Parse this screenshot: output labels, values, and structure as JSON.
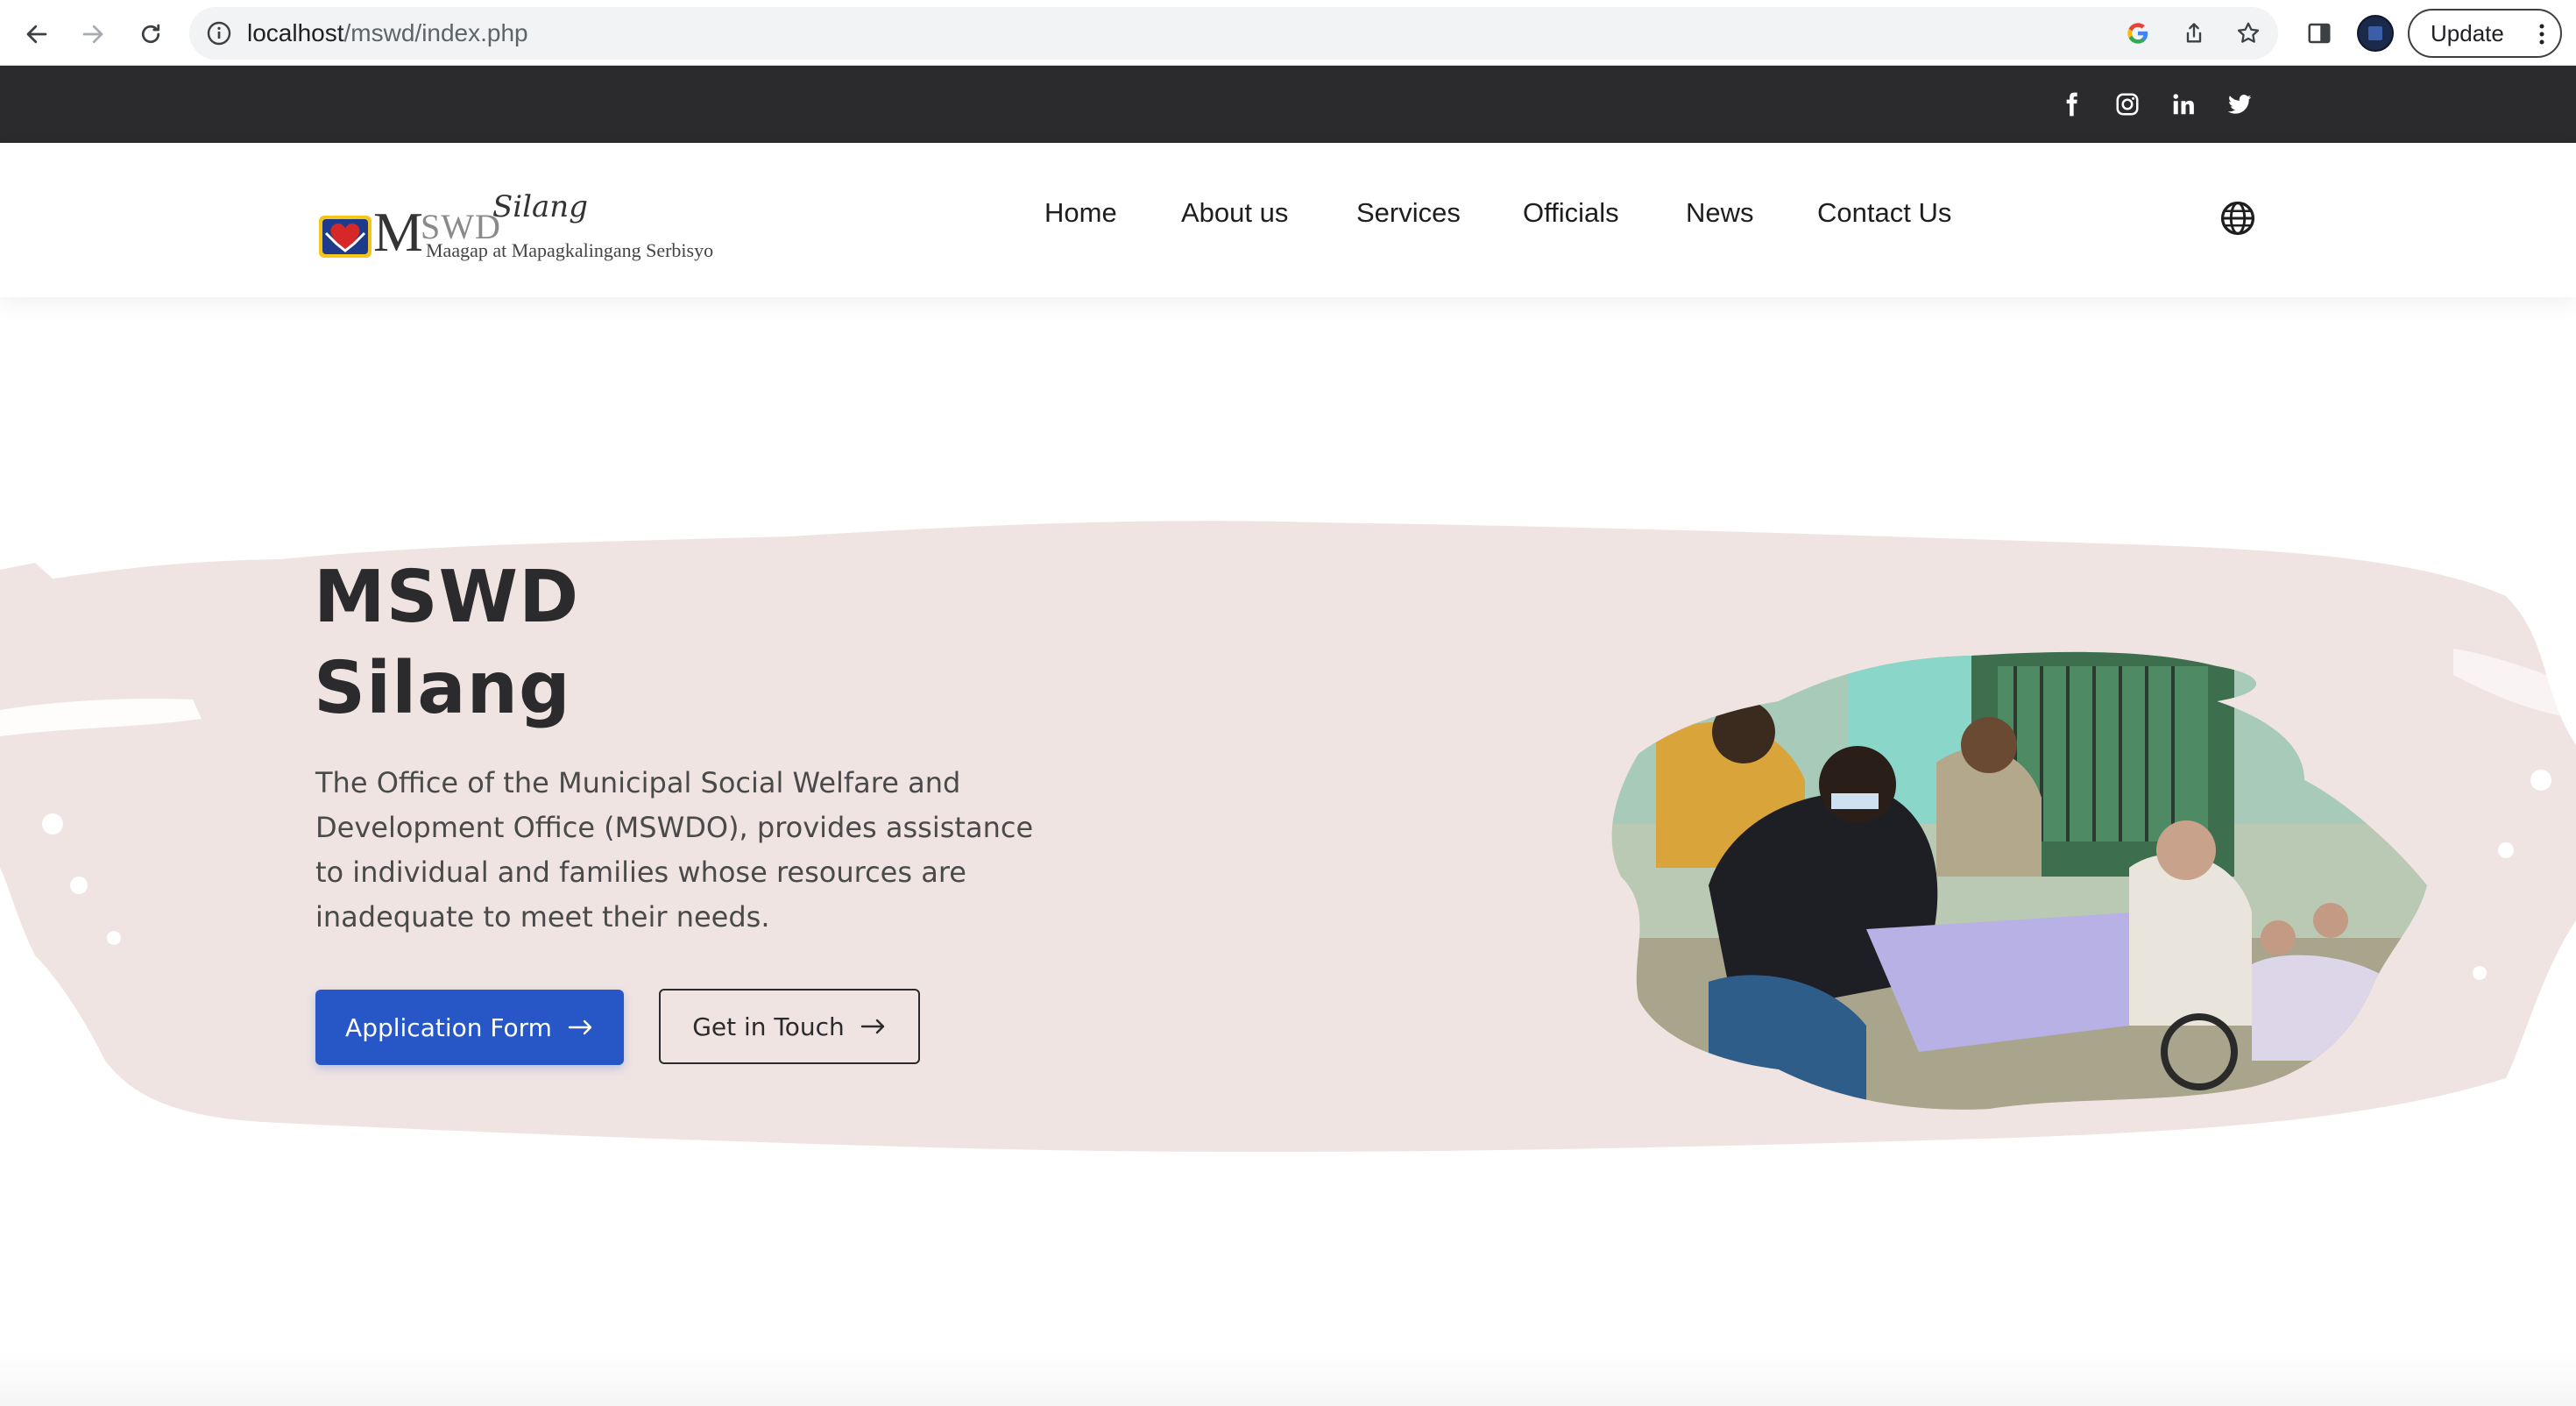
{
  "browser": {
    "url_host": "localhost",
    "url_path": "/mswd/index.php",
    "update_label": "Update"
  },
  "topbar": {
    "social_icons": [
      "facebook-icon",
      "instagram-icon",
      "linkedin-icon",
      "twitter-icon"
    ]
  },
  "header": {
    "logo": {
      "m_letter": "M",
      "swd_text": "SWD",
      "silang_text": "Silang",
      "tagline": "Maagap at Mapagkalingang Serbisyo"
    },
    "nav": [
      "Home",
      "About us",
      "Services",
      "Officials",
      "News",
      "Contact Us"
    ]
  },
  "hero": {
    "title_line1": "MSWD",
    "title_line2": "Silang",
    "description": "The Office of the Municipal Social Welfare and Development Office (MSWDO), provides assistance to individual and families whose resources are inadequate to meet their needs.",
    "primary_button": "Application Form",
    "secondary_button": "Get in Touch"
  },
  "colors": {
    "topbar": "#2b2b2d",
    "hero_bg": "#efe4e2",
    "primary": "#2757c6",
    "text_dark": "#2b2b2d"
  }
}
